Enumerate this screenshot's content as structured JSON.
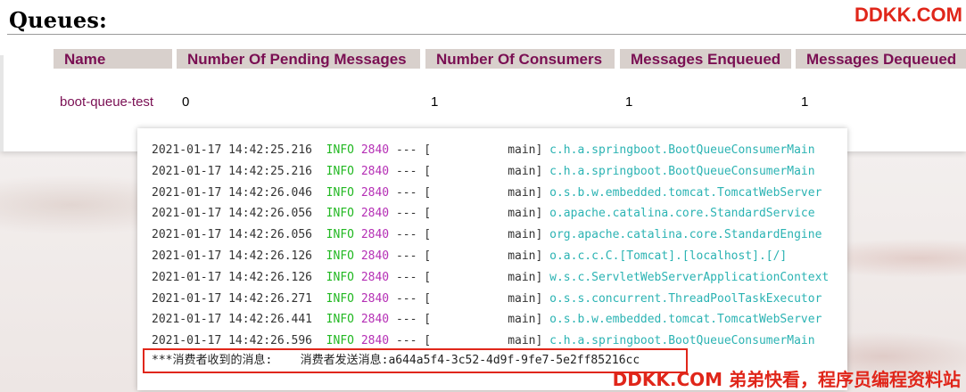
{
  "colors": {
    "watermark": "#e0261a",
    "header_bg": "#d8d0cc",
    "header_text": "#7a0f53",
    "log_level": "#22b822",
    "log_pid": "#b52fb5",
    "log_logger": "#2bb3b3",
    "highlight_border": "#e0261a"
  },
  "page": {
    "title": "Queues:",
    "watermark_top": "DDKK.COM"
  },
  "queues_table": {
    "columns": [
      "Name",
      "Number Of Pending Messages",
      "Number Of Consumers",
      "Messages Enqueued",
      "Messages Dequeued"
    ],
    "rows": [
      {
        "name": "boot-queue-test",
        "pending": "0",
        "consumers": "1",
        "enqueued": "1",
        "dequeued": "1"
      }
    ]
  },
  "console": {
    "log_lines": [
      {
        "ts": "2021-01-17 14:42:25.216",
        "level": "INFO",
        "pid": "2840",
        "sep": "--- [",
        "thread": "main]",
        "logger": "c.h.a.springboot.BootQueueConsumerMain"
      },
      {
        "ts": "2021-01-17 14:42:25.216",
        "level": "INFO",
        "pid": "2840",
        "sep": "--- [",
        "thread": "main]",
        "logger": "c.h.a.springboot.BootQueueConsumerMain"
      },
      {
        "ts": "2021-01-17 14:42:26.046",
        "level": "INFO",
        "pid": "2840",
        "sep": "--- [",
        "thread": "main]",
        "logger": "o.s.b.w.embedded.tomcat.TomcatWebServer"
      },
      {
        "ts": "2021-01-17 14:42:26.056",
        "level": "INFO",
        "pid": "2840",
        "sep": "--- [",
        "thread": "main]",
        "logger": "o.apache.catalina.core.StandardService"
      },
      {
        "ts": "2021-01-17 14:42:26.056",
        "level": "INFO",
        "pid": "2840",
        "sep": "--- [",
        "thread": "main]",
        "logger": "org.apache.catalina.core.StandardEngine"
      },
      {
        "ts": "2021-01-17 14:42:26.126",
        "level": "INFO",
        "pid": "2840",
        "sep": "--- [",
        "thread": "main]",
        "logger": "o.a.c.c.C.[Tomcat].[localhost].[/]"
      },
      {
        "ts": "2021-01-17 14:42:26.126",
        "level": "INFO",
        "pid": "2840",
        "sep": "--- [",
        "thread": "main]",
        "logger": "w.s.c.ServletWebServerApplicationContext"
      },
      {
        "ts": "2021-01-17 14:42:26.271",
        "level": "INFO",
        "pid": "2840",
        "sep": "--- [",
        "thread": "main]",
        "logger": "o.s.s.concurrent.ThreadPoolTaskExecutor"
      },
      {
        "ts": "2021-01-17 14:42:26.441",
        "level": "INFO",
        "pid": "2840",
        "sep": "--- [",
        "thread": "main]",
        "logger": "o.s.b.w.embedded.tomcat.TomcatWebServer"
      },
      {
        "ts": "2021-01-17 14:42:26.596",
        "level": "INFO",
        "pid": "2840",
        "sep": "--- [",
        "thread": "main]",
        "logger": "c.h.a.springboot.BootQueueConsumerMain"
      }
    ],
    "received_prefix": "***消费者收到的消息:",
    "received_message": "消费者发送消息:a644a5f4-3c52-4d9f-9fe7-5e2ff85216cc"
  },
  "watermark_bottom": "DDKK.COM 弟弟快看，程序员编程资料站"
}
